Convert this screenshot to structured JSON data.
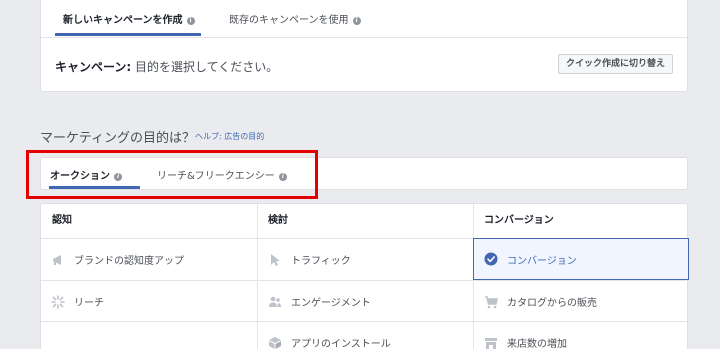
{
  "campaign_tabs": [
    {
      "label": "新しいキャンペーンを作成",
      "active": true
    },
    {
      "label": "既存のキャンペーンを使用",
      "active": false
    }
  ],
  "campaign": {
    "label": "キャンペーン:",
    "value": "目的を選択してください。",
    "quick_button": "クイック作成に切り替え"
  },
  "objective": {
    "heading": "マーケティングの目的は？",
    "help_link": "ヘルプ: 広告の目的"
  },
  "buying_tabs": [
    {
      "label": "オークション",
      "active": true
    },
    {
      "label": "リーチ&フリークエンシー",
      "active": false
    }
  ],
  "columns": [
    {
      "header": "認知",
      "items": [
        {
          "label": "ブランドの認知度アップ",
          "icon": "megaphone-icon",
          "selected": false
        },
        {
          "label": "リーチ",
          "icon": "reach-icon",
          "selected": false
        }
      ]
    },
    {
      "header": "検討",
      "items": [
        {
          "label": "トラフィック",
          "icon": "cursor-icon",
          "selected": false
        },
        {
          "label": "エンゲージメント",
          "icon": "people-icon",
          "selected": false
        },
        {
          "label": "アプリのインストール",
          "icon": "box-icon",
          "selected": false
        }
      ]
    },
    {
      "header": "コンバージョン",
      "items": [
        {
          "label": "コンバージョン",
          "icon": "check-circle-icon",
          "selected": true
        },
        {
          "label": "カタログからの販売",
          "icon": "cart-icon",
          "selected": false
        },
        {
          "label": "来店数の増加",
          "icon": "store-icon",
          "selected": false
        }
      ]
    }
  ],
  "colors": {
    "accent": "#4267b2",
    "highlight": "#e50000",
    "background": "#e9ebee"
  }
}
